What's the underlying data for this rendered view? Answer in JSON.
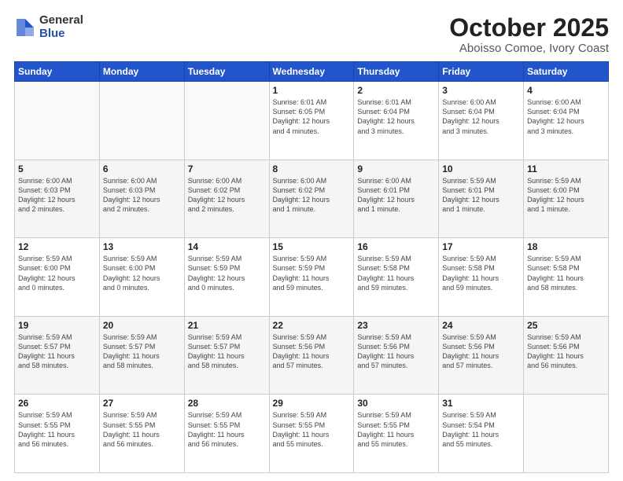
{
  "logo": {
    "general": "General",
    "blue": "Blue"
  },
  "title": "October 2025",
  "subtitle": "Aboisso Comoe, Ivory Coast",
  "weekdays": [
    "Sunday",
    "Monday",
    "Tuesday",
    "Wednesday",
    "Thursday",
    "Friday",
    "Saturday"
  ],
  "weeks": [
    [
      {
        "day": "",
        "info": ""
      },
      {
        "day": "",
        "info": ""
      },
      {
        "day": "",
        "info": ""
      },
      {
        "day": "1",
        "info": "Sunrise: 6:01 AM\nSunset: 6:05 PM\nDaylight: 12 hours\nand 4 minutes."
      },
      {
        "day": "2",
        "info": "Sunrise: 6:01 AM\nSunset: 6:04 PM\nDaylight: 12 hours\nand 3 minutes."
      },
      {
        "day": "3",
        "info": "Sunrise: 6:00 AM\nSunset: 6:04 PM\nDaylight: 12 hours\nand 3 minutes."
      },
      {
        "day": "4",
        "info": "Sunrise: 6:00 AM\nSunset: 6:04 PM\nDaylight: 12 hours\nand 3 minutes."
      }
    ],
    [
      {
        "day": "5",
        "info": "Sunrise: 6:00 AM\nSunset: 6:03 PM\nDaylight: 12 hours\nand 2 minutes."
      },
      {
        "day": "6",
        "info": "Sunrise: 6:00 AM\nSunset: 6:03 PM\nDaylight: 12 hours\nand 2 minutes."
      },
      {
        "day": "7",
        "info": "Sunrise: 6:00 AM\nSunset: 6:02 PM\nDaylight: 12 hours\nand 2 minutes."
      },
      {
        "day": "8",
        "info": "Sunrise: 6:00 AM\nSunset: 6:02 PM\nDaylight: 12 hours\nand 1 minute."
      },
      {
        "day": "9",
        "info": "Sunrise: 6:00 AM\nSunset: 6:01 PM\nDaylight: 12 hours\nand 1 minute."
      },
      {
        "day": "10",
        "info": "Sunrise: 5:59 AM\nSunset: 6:01 PM\nDaylight: 12 hours\nand 1 minute."
      },
      {
        "day": "11",
        "info": "Sunrise: 5:59 AM\nSunset: 6:00 PM\nDaylight: 12 hours\nand 1 minute."
      }
    ],
    [
      {
        "day": "12",
        "info": "Sunrise: 5:59 AM\nSunset: 6:00 PM\nDaylight: 12 hours\nand 0 minutes."
      },
      {
        "day": "13",
        "info": "Sunrise: 5:59 AM\nSunset: 6:00 PM\nDaylight: 12 hours\nand 0 minutes."
      },
      {
        "day": "14",
        "info": "Sunrise: 5:59 AM\nSunset: 5:59 PM\nDaylight: 12 hours\nand 0 minutes."
      },
      {
        "day": "15",
        "info": "Sunrise: 5:59 AM\nSunset: 5:59 PM\nDaylight: 11 hours\nand 59 minutes."
      },
      {
        "day": "16",
        "info": "Sunrise: 5:59 AM\nSunset: 5:58 PM\nDaylight: 11 hours\nand 59 minutes."
      },
      {
        "day": "17",
        "info": "Sunrise: 5:59 AM\nSunset: 5:58 PM\nDaylight: 11 hours\nand 59 minutes."
      },
      {
        "day": "18",
        "info": "Sunrise: 5:59 AM\nSunset: 5:58 PM\nDaylight: 11 hours\nand 58 minutes."
      }
    ],
    [
      {
        "day": "19",
        "info": "Sunrise: 5:59 AM\nSunset: 5:57 PM\nDaylight: 11 hours\nand 58 minutes."
      },
      {
        "day": "20",
        "info": "Sunrise: 5:59 AM\nSunset: 5:57 PM\nDaylight: 11 hours\nand 58 minutes."
      },
      {
        "day": "21",
        "info": "Sunrise: 5:59 AM\nSunset: 5:57 PM\nDaylight: 11 hours\nand 58 minutes."
      },
      {
        "day": "22",
        "info": "Sunrise: 5:59 AM\nSunset: 5:56 PM\nDaylight: 11 hours\nand 57 minutes."
      },
      {
        "day": "23",
        "info": "Sunrise: 5:59 AM\nSunset: 5:56 PM\nDaylight: 11 hours\nand 57 minutes."
      },
      {
        "day": "24",
        "info": "Sunrise: 5:59 AM\nSunset: 5:56 PM\nDaylight: 11 hours\nand 57 minutes."
      },
      {
        "day": "25",
        "info": "Sunrise: 5:59 AM\nSunset: 5:56 PM\nDaylight: 11 hours\nand 56 minutes."
      }
    ],
    [
      {
        "day": "26",
        "info": "Sunrise: 5:59 AM\nSunset: 5:55 PM\nDaylight: 11 hours\nand 56 minutes."
      },
      {
        "day": "27",
        "info": "Sunrise: 5:59 AM\nSunset: 5:55 PM\nDaylight: 11 hours\nand 56 minutes."
      },
      {
        "day": "28",
        "info": "Sunrise: 5:59 AM\nSunset: 5:55 PM\nDaylight: 11 hours\nand 56 minutes."
      },
      {
        "day": "29",
        "info": "Sunrise: 5:59 AM\nSunset: 5:55 PM\nDaylight: 11 hours\nand 55 minutes."
      },
      {
        "day": "30",
        "info": "Sunrise: 5:59 AM\nSunset: 5:55 PM\nDaylight: 11 hours\nand 55 minutes."
      },
      {
        "day": "31",
        "info": "Sunrise: 5:59 AM\nSunset: 5:54 PM\nDaylight: 11 hours\nand 55 minutes."
      },
      {
        "day": "",
        "info": ""
      }
    ]
  ]
}
